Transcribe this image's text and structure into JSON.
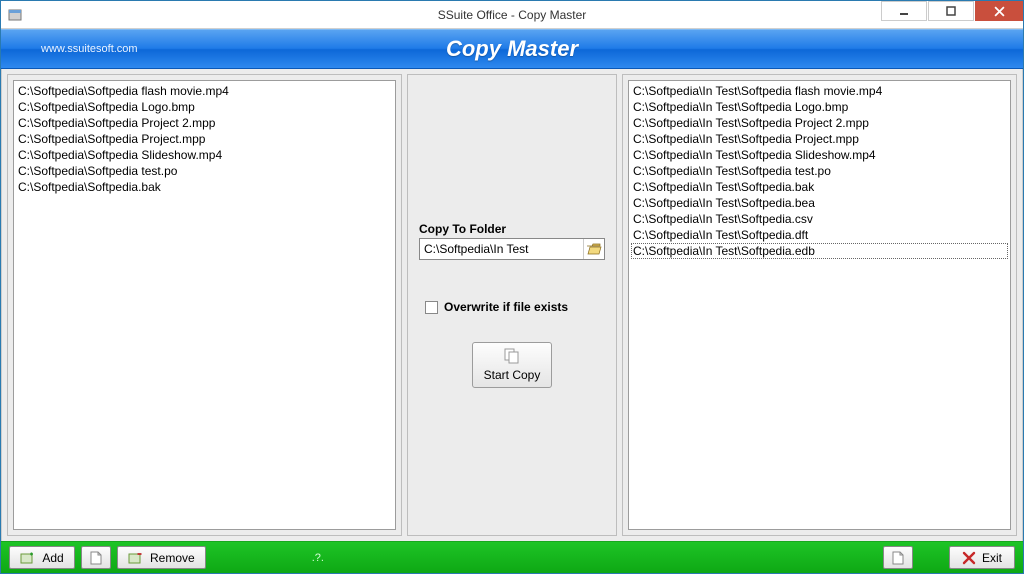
{
  "window": {
    "title": "SSuite Office - Copy Master"
  },
  "header": {
    "url": "www.ssuitesoft.com",
    "title": "Copy Master"
  },
  "left_list": {
    "items": [
      "C:\\Softpedia\\Softpedia flash movie.mp4",
      "C:\\Softpedia\\Softpedia Logo.bmp",
      "C:\\Softpedia\\Softpedia Project 2.mpp",
      "C:\\Softpedia\\Softpedia Project.mpp",
      "C:\\Softpedia\\Softpedia Slideshow.mp4",
      "C:\\Softpedia\\Softpedia test.po",
      "C:\\Softpedia\\Softpedia.bak"
    ]
  },
  "center": {
    "copy_to_label": "Copy To Folder",
    "copy_to_value": "C:\\Softpedia\\In Test",
    "overwrite_label": "Overwrite if file exists",
    "overwrite_checked": false,
    "start_copy_label": "Start Copy"
  },
  "right_list": {
    "items": [
      "C:\\Softpedia\\In Test\\Softpedia flash movie.mp4",
      "C:\\Softpedia\\In Test\\Softpedia Logo.bmp",
      "C:\\Softpedia\\In Test\\Softpedia Project 2.mpp",
      "C:\\Softpedia\\In Test\\Softpedia Project.mpp",
      "C:\\Softpedia\\In Test\\Softpedia Slideshow.mp4",
      "C:\\Softpedia\\In Test\\Softpedia test.po",
      "C:\\Softpedia\\In Test\\Softpedia.bak",
      "C:\\Softpedia\\In Test\\Softpedia.bea",
      "C:\\Softpedia\\In Test\\Softpedia.csv",
      "C:\\Softpedia\\In Test\\Softpedia.dft",
      "C:\\Softpedia\\In Test\\Softpedia.edb"
    ],
    "focused_index": 10
  },
  "footer": {
    "add_label": "Add",
    "remove_label": "Remove",
    "exit_label": "Exit",
    "hint": ".?."
  }
}
